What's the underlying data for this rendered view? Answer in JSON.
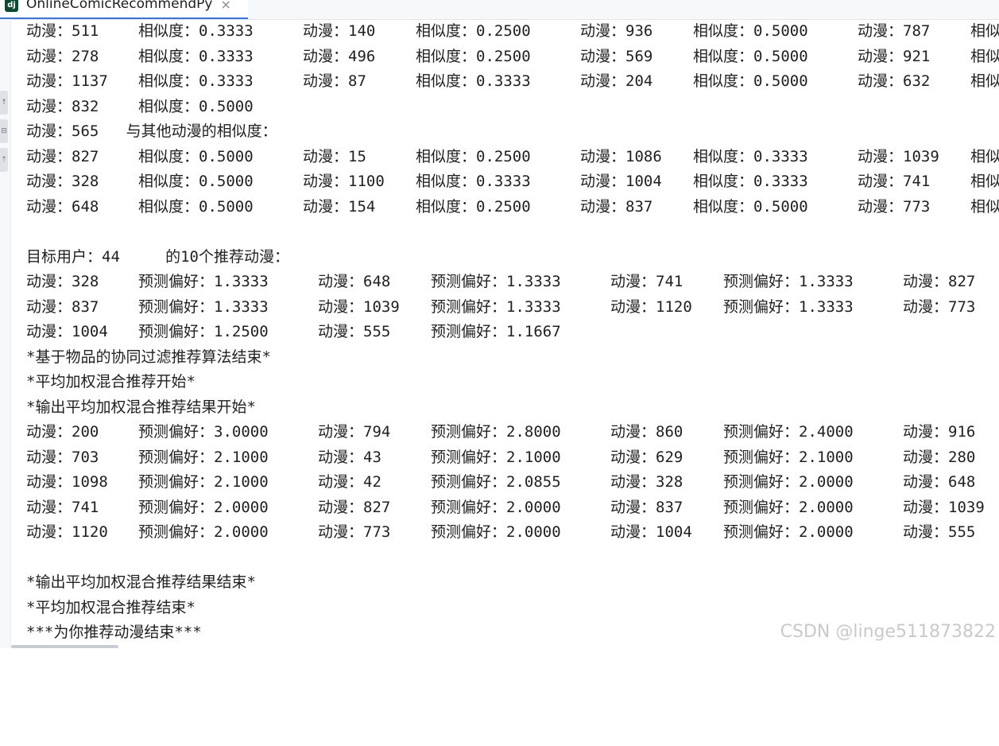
{
  "tab": {
    "title": "OnlineComicRecommendPy",
    "icon_letter": "dj",
    "close_glyph": "×"
  },
  "gutter": {
    "buttons": [
      "↑",
      "⊟",
      "⇡"
    ]
  },
  "console": {
    "sim_rows_a": [
      [
        "动漫：511",
        "相似度：0.3333",
        "动漫：140",
        "相似度：0.2500",
        "动漫：936",
        "相似度：0.5000",
        "动漫：787",
        "相似"
      ],
      [
        "动漫：278",
        "相似度：0.3333",
        "动漫：496",
        "相似度：0.2500",
        "动漫：569",
        "相似度：0.5000",
        "动漫：921",
        "相似"
      ],
      [
        "动漫：1137",
        "相似度：0.3333",
        "动漫：87",
        "相似度：0.3333",
        "动漫：204",
        "相似度：0.5000",
        "动漫：632",
        "相似"
      ],
      [
        "动漫：832",
        "相似度：0.5000",
        "",
        "",
        "",
        "",
        "",
        ""
      ]
    ],
    "sim_header": "动漫：565   与其他动漫的相似度：",
    "sim_rows_b": [
      [
        "动漫：827",
        "相似度：0.5000",
        "动漫：15",
        "相似度：0.2500",
        "动漫：1086",
        "相似度：0.3333",
        "动漫：1039",
        "相似"
      ],
      [
        "动漫：328",
        "相似度：0.5000",
        "动漫：1100",
        "相似度：0.3333",
        "动漫：1004",
        "相似度：0.3333",
        "动漫：741",
        "相似"
      ],
      [
        "动漫：648",
        "相似度：0.5000",
        "动漫：154",
        "相似度：0.2500",
        "动漫：837",
        "相似度：0.5000",
        "动漫：773",
        "相似"
      ]
    ],
    "target_line": "目标用户：44     的10个推荐动漫：",
    "rec_rows": [
      [
        "动漫：328",
        "预测偏好：1.3333",
        "动漫：648",
        "预测偏好：1.3333",
        "动漫：741",
        "预测偏好：1.3333",
        "动漫：827"
      ],
      [
        "动漫：837",
        "预测偏好：1.3333",
        "动漫：1039",
        "预测偏好：1.3333",
        "动漫：1120",
        "预测偏好：1.3333",
        "动漫：773"
      ],
      [
        "动漫：1004",
        "预测偏好：1.2500",
        "动漫：555",
        "预测偏好：1.1667",
        "",
        "",
        ""
      ]
    ],
    "msg_item_end": "*基于物品的协同过滤推荐算法结束*",
    "msg_hybrid_start": "*平均加权混合推荐开始*",
    "msg_output_start": "*输出平均加权混合推荐结果开始*",
    "hybrid_rows": [
      [
        "动漫：200",
        "预测偏好：3.0000",
        "动漫：794",
        "预测偏好：2.8000",
        "动漫：860",
        "预测偏好：2.4000",
        "动漫：916"
      ],
      [
        "动漫：703",
        "预测偏好：2.1000",
        "动漫：43",
        "预测偏好：2.1000",
        "动漫：629",
        "预测偏好：2.1000",
        "动漫：280"
      ],
      [
        "动漫：1098",
        "预测偏好：2.1000",
        "动漫：42",
        "预测偏好：2.0855",
        "动漫：328",
        "预测偏好：2.0000",
        "动漫：648"
      ],
      [
        "动漫：741",
        "预测偏好：2.0000",
        "动漫：827",
        "预测偏好：2.0000",
        "动漫：837",
        "预测偏好：2.0000",
        "动漫：1039"
      ],
      [
        "动漫：1120",
        "预测偏好：2.0000",
        "动漫：773",
        "预测偏好：2.0000",
        "动漫：1004",
        "预测偏好：2.0000",
        "动漫：555"
      ]
    ],
    "msg_output_end": "*输出平均加权混合推荐结果结束*",
    "msg_hybrid_end": "*平均加权混合推荐结束*",
    "msg_all_end": "***为你推荐动漫结束***"
  },
  "watermark": "CSDN @linge511873822"
}
